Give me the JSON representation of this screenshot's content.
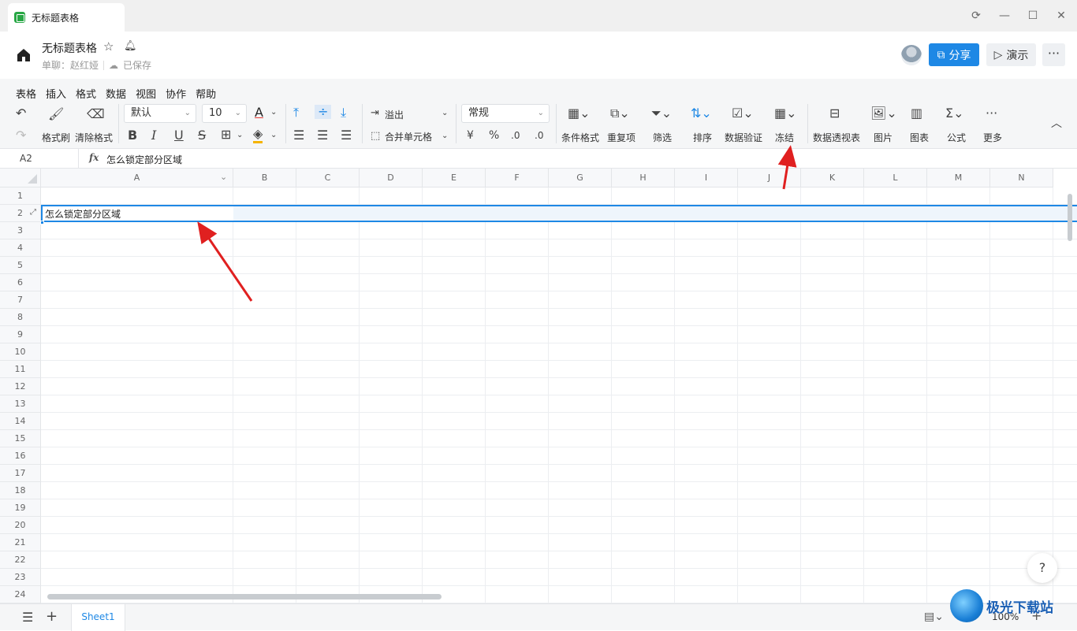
{
  "window": {
    "tab_title": "无标题表格",
    "controls": [
      "refresh-icon",
      "minimize-icon",
      "maximize-icon",
      "close-icon"
    ]
  },
  "doc": {
    "title": "无标题表格",
    "chat": "单聊：赵红娅",
    "saved": "已保存",
    "share_label": "分享",
    "present_label": "演示",
    "more_label": "···"
  },
  "menu": [
    "表格",
    "插入",
    "格式",
    "数据",
    "视图",
    "协作",
    "帮助"
  ],
  "toolbar": {
    "format_painter": "格式刷",
    "clear_format": "清除格式",
    "font": "默认",
    "font_size": "10",
    "overflow": "溢出",
    "merge": "合并单元格",
    "number_format": "常规",
    "conditional": "条件格式",
    "duplicates": "重复项",
    "filter": "筛选",
    "sort": "排序",
    "validation": "数据验证",
    "freeze": "冻结",
    "pivot": "数据透视表",
    "image": "图片",
    "chart": "图表",
    "formula": "公式",
    "more": "更多",
    "bold": "B",
    "italic": "I",
    "underline": "U",
    "strike": "S",
    "currency": "¥",
    "percent": "%",
    "font_color": "A"
  },
  "formula_bar": {
    "cell_ref": "A2",
    "fx": "fx",
    "value": "怎么锁定部分区域"
  },
  "grid": {
    "columns": [
      "A",
      "B",
      "C",
      "D",
      "E",
      "F",
      "G",
      "H",
      "I",
      "J",
      "K",
      "L",
      "M",
      "N"
    ],
    "rows": [
      "1",
      "2",
      "3",
      "4",
      "5",
      "6",
      "7",
      "8",
      "9",
      "10",
      "11",
      "12",
      "13",
      "14",
      "15",
      "16",
      "17",
      "18",
      "19",
      "20",
      "21",
      "22",
      "23",
      "24"
    ],
    "a2": "怎么锁定部分区域"
  },
  "bottom": {
    "sheet": "Sheet1",
    "zoom": "100%"
  },
  "watermark": "极光下载站",
  "colors": {
    "accent": "#1e88e5",
    "arrow": "#e02020"
  }
}
